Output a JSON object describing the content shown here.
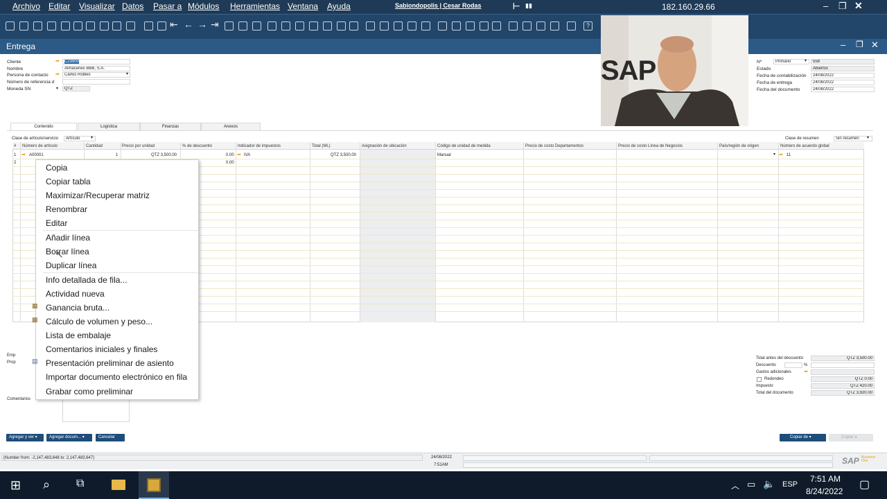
{
  "menu": [
    "Archivo",
    "Editar",
    "Visualizar",
    "Datos",
    "Pasar a",
    "Módulos",
    "Herramientas",
    "Ventana",
    "Ayuda"
  ],
  "session_user": "Sabiondopolis | Cesar Rodas",
  "server_ip": "182.160.29.66",
  "window_title": "Entrega",
  "header_left": {
    "cliente_label": "Cliente",
    "cliente_value": "C23900",
    "nombre_label": "Nombre",
    "nombre_value": "Almacenes BBB, S.A.",
    "contacto_label": "Persona de contacto",
    "contacto_value": "Carlos Robles",
    "referencia_label": "Número de referencia d",
    "moneda_label": "Moneda SN",
    "moneda_value": "QTZ"
  },
  "header_right": {
    "num_label": "Nº",
    "series_value": "Primario",
    "num_value": "558",
    "estado_label": "Estado",
    "estado_value": "Abiertos",
    "contab_label": "Fecha de contabilización",
    "contab_value": "24/08/2022",
    "entrega_label": "Fecha de entrega",
    "entrega_value": "24/08/2022",
    "documento_label": "Fecha del documento",
    "documento_value": "24/08/2022"
  },
  "tabs": [
    "Contenido",
    "Logística",
    "Finanzas",
    "Anexos"
  ],
  "clase_articulo_label": "Clase de artículo/servicio",
  "clase_articulo_value": "Artículo",
  "clase_resumen_label": "Clase de resumen",
  "clase_resumen_value": "Sin resumen",
  "columns": [
    "#",
    "Número de artículo",
    "Cantidad",
    "Precio por unidad",
    "% de descuento",
    "Indicador de impuestos",
    "Total (ML)",
    "Asignación de ubicación",
    "Código de unidad de medida",
    "Precio de costo Departamentos",
    "Precio de costo Línea de Negocios",
    "País/región de origen",
    "Número de acuerdo global"
  ],
  "row1": {
    "num": "1",
    "item": "A00001",
    "qty": "1",
    "price": "QTZ 3,500.00",
    "discount": "0.00",
    "tax": "IVA",
    "total": "QTZ 3,500.00",
    "uom": "Manual",
    "agreement": "11"
  },
  "row2": {
    "num": "2",
    "discount": "0.00"
  },
  "context_menu": [
    "Copia",
    "Copiar tabla",
    "Maximizar/Recuperar matriz",
    "Renombrar",
    "Editar",
    "Añadir línea",
    "Borrar línea",
    "Duplicar línea",
    "Info detallada de fila...",
    "Actividad nueva",
    "Ganancia bruta...",
    "Cálculo de volumen y peso...",
    "Lista de embalaje",
    "Comentarios iniciales y finales",
    "Presentación preliminar de asiento",
    "Importar documento electrónico en fila",
    "Grabar como preliminar"
  ],
  "bottom_left": {
    "empleado_label": "Emp",
    "propietario_label": "Prop",
    "comentarios_label": "Comentarios"
  },
  "totals": {
    "antes_label": "Total antes del descuento",
    "antes_value": "QTZ 3,500.00",
    "descuento_label": "Descuento",
    "pct": "%",
    "gastos_label": "Gastos adicionales",
    "redondeo_label": "Redondeo",
    "redondeo_value": "QTZ 0.00",
    "impuesto_label": "Impuesto",
    "impuesto_value": "QTZ 420.00",
    "total_label": "Total del documento",
    "total_value": "QTZ 3,920.00"
  },
  "buttons": {
    "agregar_ver": "Agregar y ver",
    "agregar_doc": "Agregar docum...",
    "cancelar": "Cancelar",
    "copiar_de": "Copiar de",
    "copiar_a": "Copiar a"
  },
  "status": {
    "message": "(Number from: -2,147,483,648 to: 2,147,483,647)",
    "date": "24/08/2022",
    "time": "7:51AM",
    "logo": "SAP",
    "logo_sub": "Business One"
  },
  "taskbar": {
    "lang": "ESP",
    "time": "7:51 AM",
    "date": "8/24/2022"
  },
  "webcam": {
    "logo_text": "SAP"
  },
  "colors": {
    "menubar": "#1e3a56",
    "toolbar": "#22456a",
    "title": "#2c5a87",
    "accent": "#e6a11a",
    "button": "#1e4d7a"
  }
}
